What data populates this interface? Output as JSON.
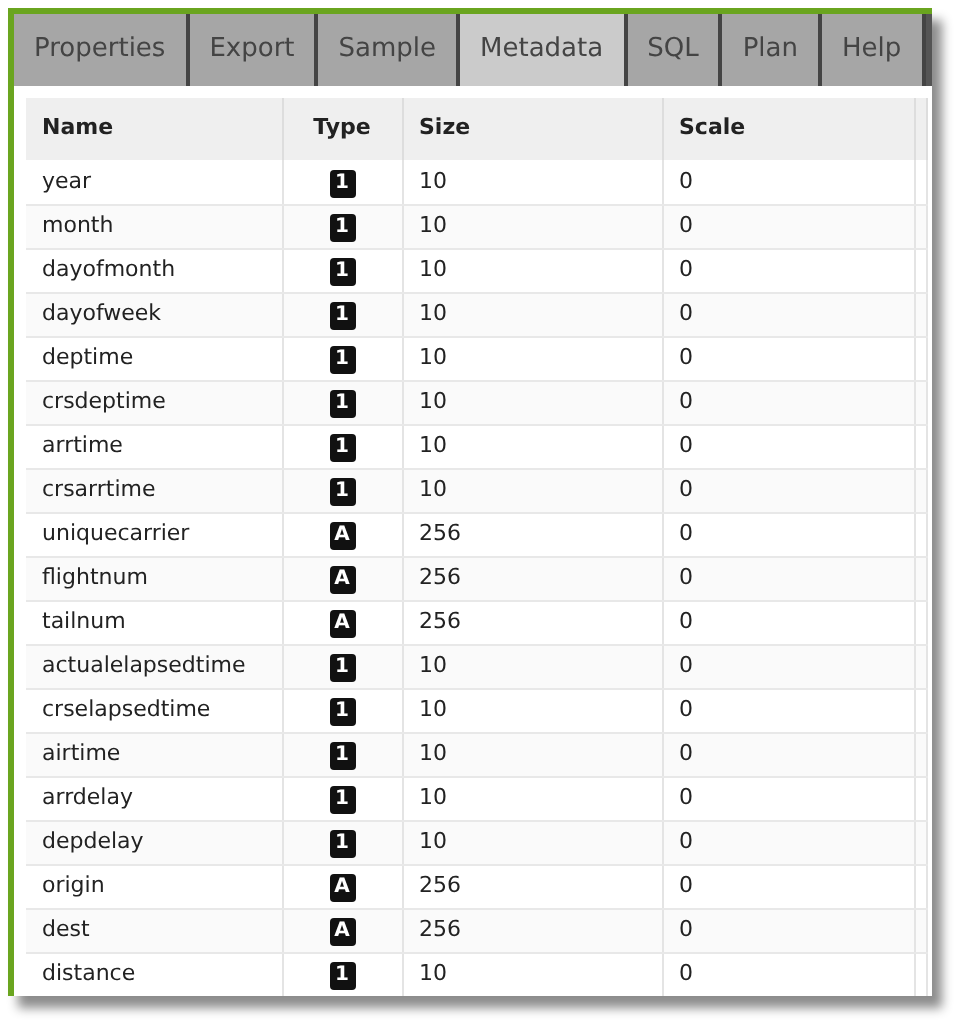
{
  "tabs": [
    {
      "label": "Properties",
      "selected": false
    },
    {
      "label": "Export",
      "selected": false
    },
    {
      "label": "Sample",
      "selected": false
    },
    {
      "label": "Metadata",
      "selected": true
    },
    {
      "label": "SQL",
      "selected": false
    },
    {
      "label": "Plan",
      "selected": false
    },
    {
      "label": "Help",
      "selected": false
    }
  ],
  "table": {
    "columns": [
      "Name",
      "Type",
      "Size",
      "Scale"
    ],
    "rows": [
      {
        "name": "year",
        "type": "1",
        "size": "10",
        "scale": "0"
      },
      {
        "name": "month",
        "type": "1",
        "size": "10",
        "scale": "0"
      },
      {
        "name": "dayofmonth",
        "type": "1",
        "size": "10",
        "scale": "0"
      },
      {
        "name": "dayofweek",
        "type": "1",
        "size": "10",
        "scale": "0"
      },
      {
        "name": "deptime",
        "type": "1",
        "size": "10",
        "scale": "0"
      },
      {
        "name": "crsdeptime",
        "type": "1",
        "size": "10",
        "scale": "0"
      },
      {
        "name": "arrtime",
        "type": "1",
        "size": "10",
        "scale": "0"
      },
      {
        "name": "crsarrtime",
        "type": "1",
        "size": "10",
        "scale": "0"
      },
      {
        "name": "uniquecarrier",
        "type": "A",
        "size": "256",
        "scale": "0"
      },
      {
        "name": "flightnum",
        "type": "A",
        "size": "256",
        "scale": "0"
      },
      {
        "name": "tailnum",
        "type": "A",
        "size": "256",
        "scale": "0"
      },
      {
        "name": "actualelapsedtime",
        "type": "1",
        "size": "10",
        "scale": "0"
      },
      {
        "name": "crselapsedtime",
        "type": "1",
        "size": "10",
        "scale": "0"
      },
      {
        "name": "airtime",
        "type": "1",
        "size": "10",
        "scale": "0"
      },
      {
        "name": "arrdelay",
        "type": "1",
        "size": "10",
        "scale": "0"
      },
      {
        "name": "depdelay",
        "type": "1",
        "size": "10",
        "scale": "0"
      },
      {
        "name": "origin",
        "type": "A",
        "size": "256",
        "scale": "0"
      },
      {
        "name": "dest",
        "type": "A",
        "size": "256",
        "scale": "0"
      },
      {
        "name": "distance",
        "type": "1",
        "size": "10",
        "scale": "0"
      }
    ]
  }
}
